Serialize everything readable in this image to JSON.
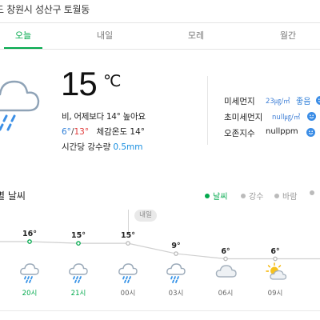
{
  "location": "도 창원시 성산구 토월동",
  "tabs": [
    {
      "label": "오늘",
      "active": true
    },
    {
      "label": "내일",
      "active": false
    },
    {
      "label": "모레",
      "active": false
    },
    {
      "label": "월간",
      "active": false
    }
  ],
  "current": {
    "icon": "rain-cloud-icon",
    "temperature": "15",
    "unit": "℃",
    "summary": "비, 어제보다 14° 높아요",
    "min": "6°",
    "max": "13°",
    "feels_like": "체감온도 14°",
    "rain_label": "시간당 강수량",
    "rain_value": "0.5mm"
  },
  "air": [
    {
      "label": "미세먼지",
      "value": "23㎍/㎥",
      "grade": "좋음"
    },
    {
      "label": "초미세먼지",
      "value": "null㎍/㎥",
      "grade": ""
    },
    {
      "label": "오존지수",
      "value": "nullppm",
      "grade": ""
    }
  ],
  "hourly_title": "별 날씨",
  "legend": [
    {
      "label": "날씨",
      "color": "#03a94d",
      "active": true
    },
    {
      "label": "강수",
      "color": "#bbbbbb",
      "active": false
    },
    {
      "label": "바람",
      "color": "#bbbbbb",
      "active": false
    }
  ],
  "tomorrow_badge": "내일",
  "chart_data": {
    "type": "line",
    "series": [
      {
        "values": [
          16,
          15,
          15,
          9,
          6,
          6
        ]
      }
    ],
    "labels": [
      "16°",
      "15°",
      "15°",
      "9°",
      "6°",
      "6°"
    ],
    "hours": [
      "20시",
      "21시",
      "00시",
      "03시",
      "06시",
      "09시"
    ],
    "icons": [
      "rain-icon",
      "rain-icon",
      "rain-icon",
      "rain-icon",
      "cloud-icon",
      "sun-cloud-icon"
    ],
    "today_count": 2
  }
}
